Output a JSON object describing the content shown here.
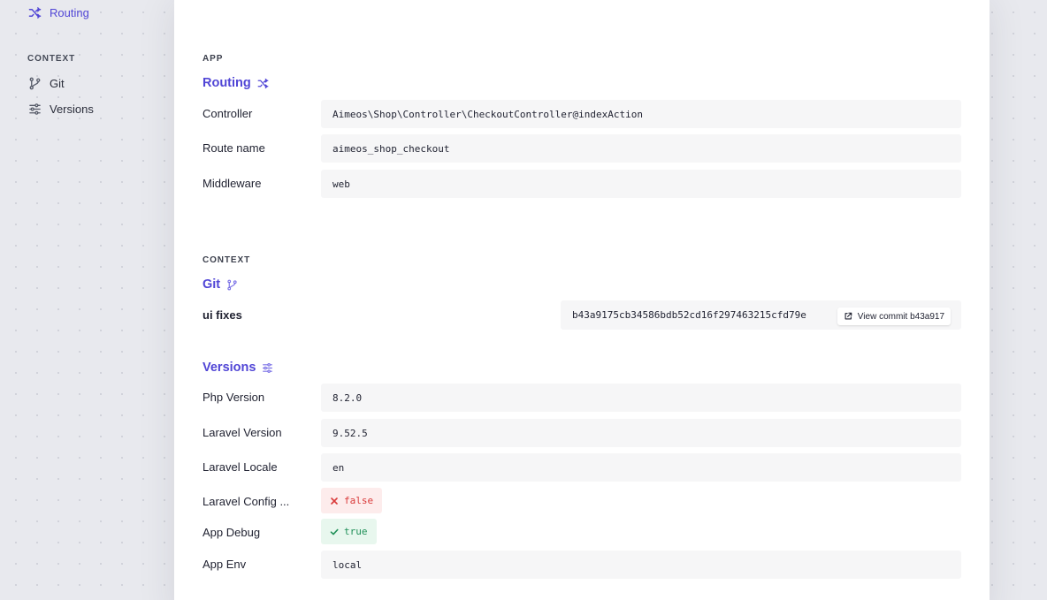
{
  "sidebar": {
    "routing_label": "Routing",
    "context_heading": "CONTEXT",
    "git_label": "Git",
    "versions_label": "Versions"
  },
  "app_section": {
    "label": "APP",
    "title": "Routing",
    "rows": [
      {
        "label": "Controller",
        "value": "Aimeos\\Shop\\Controller\\CheckoutController@indexAction"
      },
      {
        "label": "Route name",
        "value": "aimeos_shop_checkout"
      },
      {
        "label": "Middleware",
        "value": "web"
      }
    ]
  },
  "context_section": {
    "label": "CONTEXT",
    "git": {
      "title": "Git",
      "message": "ui fixes",
      "hash": "b43a9175cb34586bdb52cd16f297463215cfd79e",
      "commit_button": "View commit b43a917"
    },
    "versions": {
      "title": "Versions",
      "rows": [
        {
          "label": "Php Version",
          "value": "8.2.0"
        },
        {
          "label": "Laravel Version",
          "value": "9.52.5"
        },
        {
          "label": "Laravel Locale",
          "value": "en"
        },
        {
          "label": "Laravel Config ...",
          "value": "false"
        },
        {
          "label": "App Debug",
          "value": "true"
        },
        {
          "label": "App Env",
          "value": "local"
        }
      ]
    }
  },
  "colors": {
    "accent": "#5146d6",
    "false_text": "#d93a3a",
    "true_text": "#209058"
  }
}
